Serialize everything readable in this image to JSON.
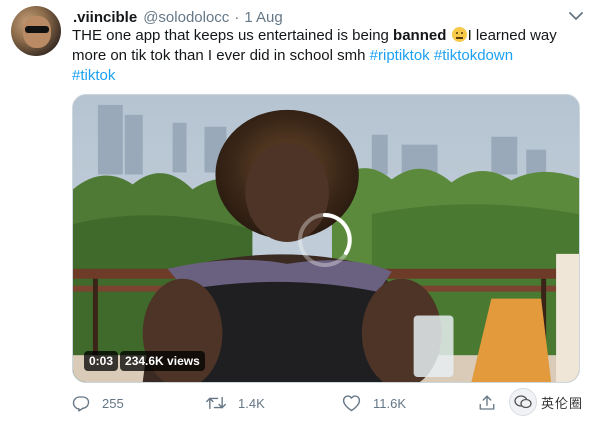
{
  "tweet": {
    "display_name": ".viincible",
    "handle": "@solodolocc",
    "separator": "·",
    "time": "1 Aug",
    "text_part1": "THE one app that keeps us entertained is being ",
    "text_bold": "banned",
    "text_part2": "I learned way more on tik tok than I ever did in school smh ",
    "hashtags": [
      "#riptiktok",
      "#tiktokdown",
      "#tiktok"
    ],
    "emoji": "neutral-face-icon"
  },
  "video": {
    "duration": "0:03",
    "views": "234.6K views"
  },
  "actions": {
    "replies": "255",
    "retweets": "1.4K",
    "likes": "11.6K"
  },
  "watermark": {
    "text": "英伦圈"
  },
  "colors": {
    "link": "#1da1f2",
    "muted": "#657786",
    "text": "#14171a"
  }
}
